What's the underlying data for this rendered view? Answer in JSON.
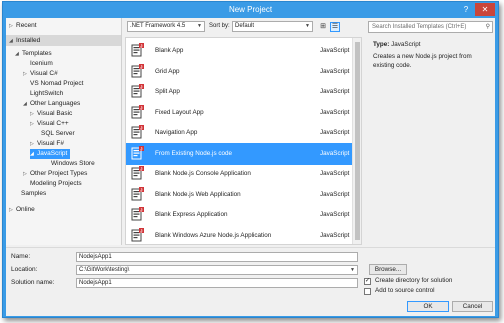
{
  "window": {
    "title": "New Project",
    "help": "?",
    "close": "✕"
  },
  "tree": {
    "recent": "Recent",
    "installed": "Installed",
    "templates": "Templates",
    "icenium": "Icenium",
    "visual_cs": "Visual C#",
    "vs_nomad": "VS Nomad Project",
    "lightswitch": "LightSwitch",
    "other_languages": "Other Languages",
    "visual_basic": "Visual Basic",
    "visual_cpp": "Visual C++",
    "sql_server": "SQL Server",
    "visual_fs": "Visual F#",
    "javascript": "JavaScript",
    "windows_store": "Windows Store",
    "other_project_types": "Other Project Types",
    "modeling_projects": "Modeling Projects",
    "samples": "Samples",
    "online": "Online"
  },
  "toolbar": {
    "framework": ".NET Framework 4.5",
    "sort_label": "Sort by:",
    "sort_value": "Default"
  },
  "templates": [
    {
      "name": "Blank App",
      "lang": "JavaScript"
    },
    {
      "name": "Grid App",
      "lang": "JavaScript"
    },
    {
      "name": "Split App",
      "lang": "JavaScript"
    },
    {
      "name": "Fixed Layout App",
      "lang": "JavaScript"
    },
    {
      "name": "Navigation App",
      "lang": "JavaScript"
    },
    {
      "name": "From Existing Node.js code",
      "lang": "JavaScript"
    },
    {
      "name": "Blank Node.js Console Application",
      "lang": "JavaScript"
    },
    {
      "name": "Blank Node.js Web Application",
      "lang": "JavaScript"
    },
    {
      "name": "Blank Express Application",
      "lang": "JavaScript"
    },
    {
      "name": "Blank Windows Azure Node.js Application",
      "lang": "JavaScript"
    }
  ],
  "search": {
    "placeholder": "Search Installed Templates (Ctrl+E)"
  },
  "details": {
    "type_label": "Type:",
    "type_value": "JavaScript",
    "description": "Creates a new Node.js project from existing code."
  },
  "form": {
    "name_label": "Name:",
    "name_value": "NodejsApp1",
    "location_label": "Location:",
    "location_value": "C:\\GitWork\\testing\\",
    "solution_label": "Solution name:",
    "solution_value": "NodejsApp1",
    "browse": "Browse...",
    "create_dir": "Create directory for solution",
    "add_source": "Add to source control",
    "ok": "OK",
    "cancel": "Cancel"
  },
  "colors": {
    "accent": "#3399ff",
    "title_bar": "#3a9be6",
    "close": "#c9453a"
  }
}
